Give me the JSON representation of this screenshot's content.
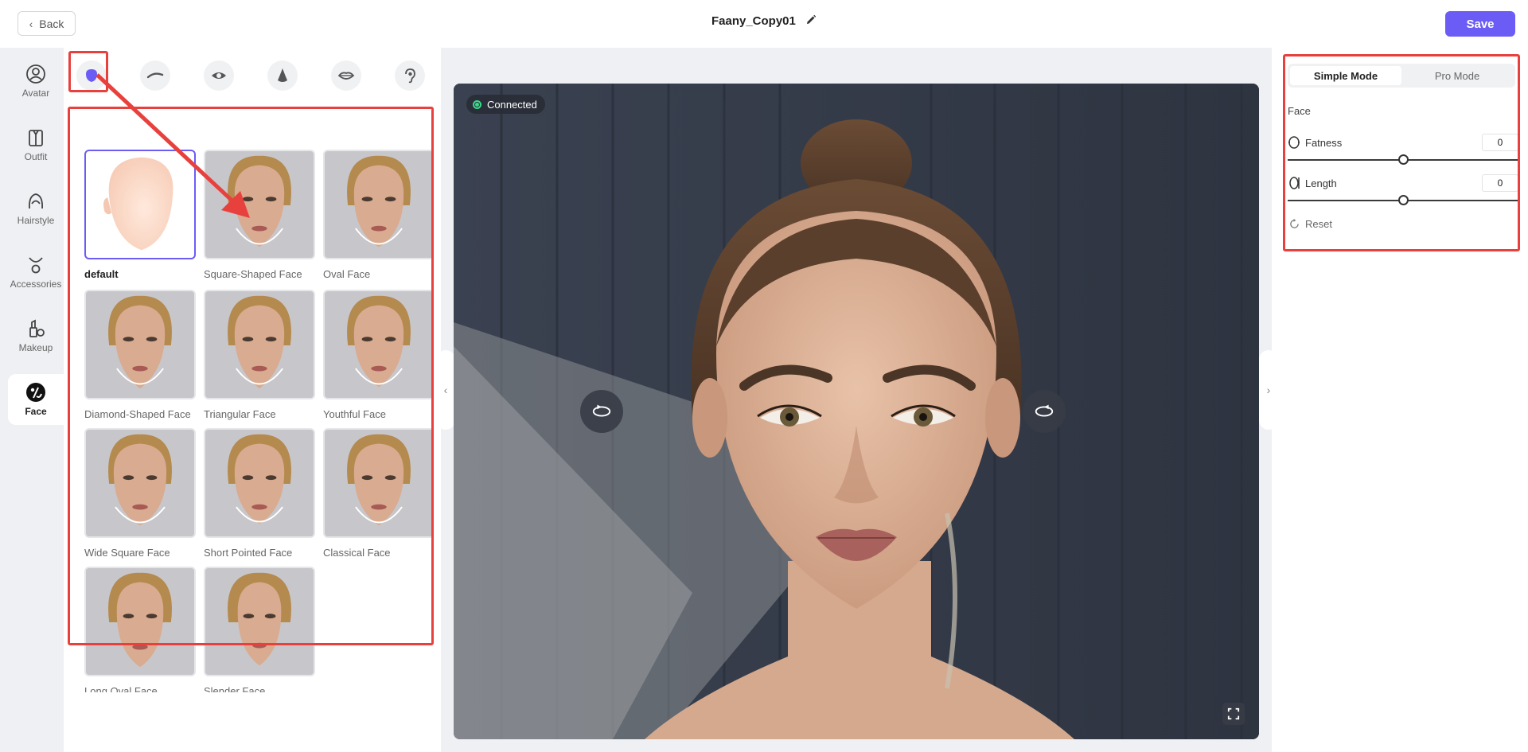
{
  "header": {
    "back_label": "Back",
    "project_title": "Faany_Copy01",
    "save_label": "Save"
  },
  "left_nav": {
    "items": [
      {
        "label": "Avatar",
        "icon": "avatar-icon",
        "active": false
      },
      {
        "label": "Outfit",
        "icon": "outfit-icon",
        "active": false
      },
      {
        "label": "Hairstyle",
        "icon": "hairstyle-icon",
        "active": false
      },
      {
        "label": "Accessories",
        "icon": "accessories-icon",
        "active": false
      },
      {
        "label": "Makeup",
        "icon": "makeup-icon",
        "active": false
      },
      {
        "label": "Face",
        "icon": "face-icon",
        "active": true
      }
    ]
  },
  "feature_categories": [
    "face-shape-icon",
    "eyebrow-icon",
    "eye-icon",
    "nose-icon",
    "lips-icon",
    "ear-icon"
  ],
  "face_presets": [
    {
      "label": "default",
      "selected": true
    },
    {
      "label": "Square-Shaped Face",
      "selected": false
    },
    {
      "label": "Oval Face",
      "selected": false
    },
    {
      "label": "Diamond-Shaped Face",
      "selected": false
    },
    {
      "label": "Triangular Face",
      "selected": false
    },
    {
      "label": "Youthful Face",
      "selected": false
    },
    {
      "label": "Wide Square Face",
      "selected": false
    },
    {
      "label": "Short Pointed Face",
      "selected": false
    },
    {
      "label": "Classical Face",
      "selected": false
    },
    {
      "label": "Long Oval Face",
      "selected": false
    },
    {
      "label": "Slender Face",
      "selected": false
    }
  ],
  "viewport": {
    "status_label": "Connected",
    "status_color": "#39d98a"
  },
  "right_panel": {
    "modes": [
      {
        "label": "Simple Mode",
        "active": true
      },
      {
        "label": "Pro Mode",
        "active": false
      }
    ],
    "section_label": "Face",
    "sliders": [
      {
        "label": "Fatness",
        "value": "0",
        "position_fraction": 0.5
      },
      {
        "label": "Length",
        "value": "0",
        "position_fraction": 0.5
      }
    ],
    "reset_label": "Reset"
  },
  "colors": {
    "accent": "#6b5cf6",
    "highlight": "#e8413d"
  }
}
